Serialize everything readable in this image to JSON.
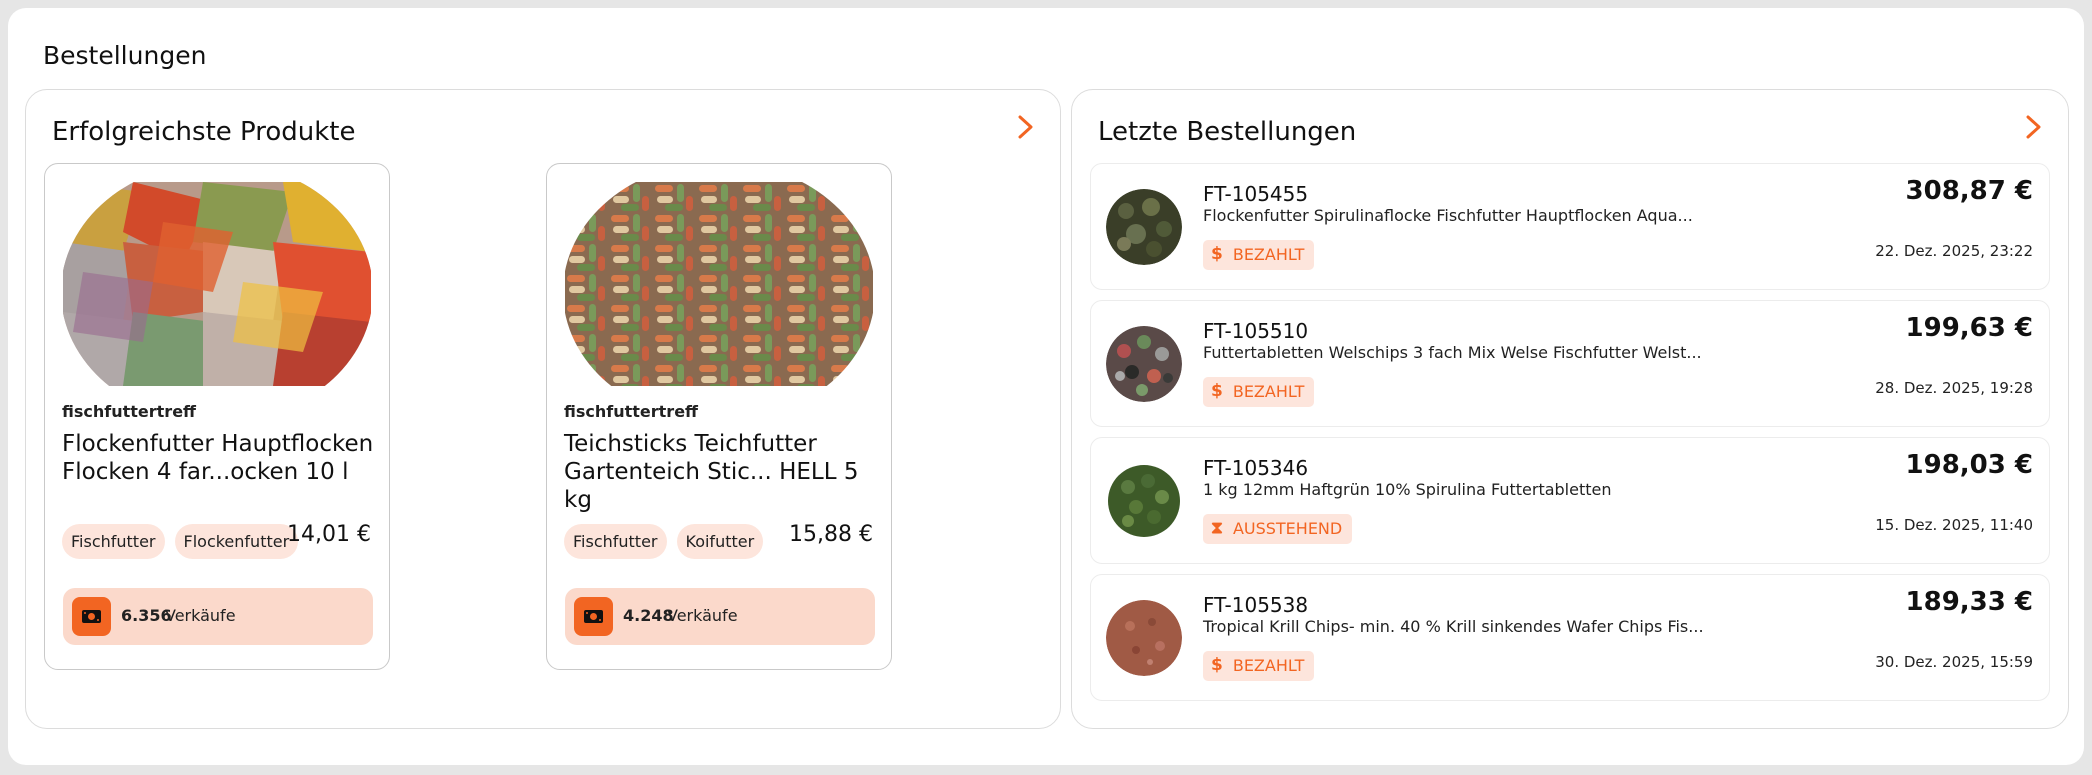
{
  "page_title": "Bestellungen",
  "top_products": {
    "title": "Erfolgreichste Produkte",
    "products": [
      {
        "vendor": "fischfuttertreff",
        "name": "Flockenfutter Hauptflocken Flocken 4 far...ocken 10 l",
        "tags": [
          "Fischfutter",
          "Flockenfutter"
        ],
        "price": "14,01 €",
        "sales_count": "6.356",
        "sales_label": "Verkäufe",
        "image_icon": "fish-flakes-image"
      },
      {
        "vendor": "fischfuttertreff",
        "name": "Teichsticks Teichfutter Gartenteich Stic... HELL 5 kg",
        "tags": [
          "Fischfutter",
          "Koifutter"
        ],
        "price": "15,88 €",
        "sales_count": "4.248",
        "sales_label": "Verkäufe",
        "image_icon": "pond-sticks-image"
      }
    ]
  },
  "recent_orders": {
    "title": "Letzte Bestellungen",
    "orders": [
      {
        "id": "FT-105455",
        "description": "Flockenfutter Spirulinaflocke Fischfutter Hauptflocken Aqua...",
        "status": "BEZAHLT",
        "status_icon": "dollar-icon",
        "amount": "308,87 €",
        "date": "22. Dez. 2025, 23:22",
        "image_color": "#4a5030"
      },
      {
        "id": "FT-105510",
        "description": "Futtertabletten Welschips 3 fach Mix Welse Fischfutter Welst...",
        "status": "BEZAHLT",
        "status_icon": "dollar-icon",
        "amount": "199,63 €",
        "date": "28. Dez. 2025, 19:28",
        "image_color": "#6e5a58"
      },
      {
        "id": "FT-105346",
        "description": "1 kg 12mm Haftgrün 10% Spirulina Futtertabletten",
        "status": "AUSSTEHEND",
        "status_icon": "hourglass-icon",
        "amount": "198,03 €",
        "date": "15. Dez. 2025, 11:40",
        "image_color": "#4d6a35"
      },
      {
        "id": "FT-105538",
        "description": "Tropical Krill Chips- min. 40 % Krill sinkendes Wafer Chips Fis...",
        "status": "BEZAHLT",
        "status_icon": "dollar-icon",
        "amount": "189,33 €",
        "date": "30. Dez. 2025, 15:59",
        "image_color": "#a05a45"
      }
    ]
  },
  "colors": {
    "accent": "#f26522",
    "tag_bg": "#fde5dc",
    "sales_bg": "#fbd9cb"
  }
}
